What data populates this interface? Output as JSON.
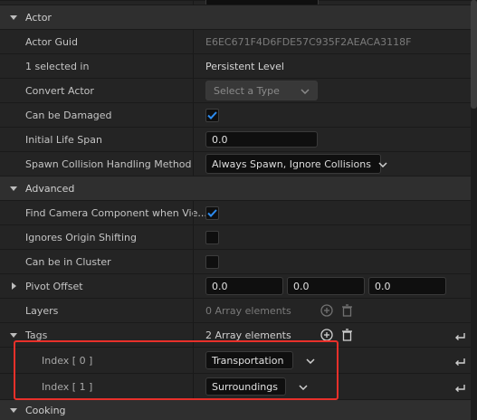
{
  "sections": {
    "actor": "Actor",
    "advanced": "Advanced",
    "cooking": "Cooking"
  },
  "props": {
    "actor_guid": {
      "name": "Actor Guid",
      "value": "E6EC671F4D6FDE57C935F2AEACA3118F"
    },
    "selected_in": {
      "name": "1 selected in",
      "value": "Persistent Level"
    },
    "convert_actor": {
      "name": "Convert Actor",
      "value": "Select a Type"
    },
    "can_be_damaged": {
      "name": "Can be Damaged",
      "checked": true
    },
    "initial_life_span": {
      "name": "Initial Life Span",
      "value": "0.0"
    },
    "spawn_collision": {
      "name": "Spawn Collision Handling Method",
      "value": "Always Spawn, Ignore Collisions"
    },
    "find_camera": {
      "name": "Find Camera Component when Vie...",
      "checked": true
    },
    "ignores_origin": {
      "name": "Ignores Origin Shifting",
      "checked": false
    },
    "can_be_in_cluster": {
      "name": "Can be in Cluster",
      "checked": false
    },
    "pivot_offset": {
      "name": "Pivot Offset",
      "x": "0.0",
      "y": "0.0",
      "z": "0.0"
    },
    "layers": {
      "name": "Layers",
      "value": "0 Array elements"
    },
    "tags": {
      "name": "Tags",
      "value": "2 Array elements"
    },
    "index0": {
      "name": "Index [ 0 ]",
      "value": "Transportation"
    },
    "index1": {
      "name": "Index [ 1 ]",
      "value": "Surroundings"
    }
  },
  "colors": {
    "accent": "#1a73e8",
    "highlight": "#e8302a"
  }
}
